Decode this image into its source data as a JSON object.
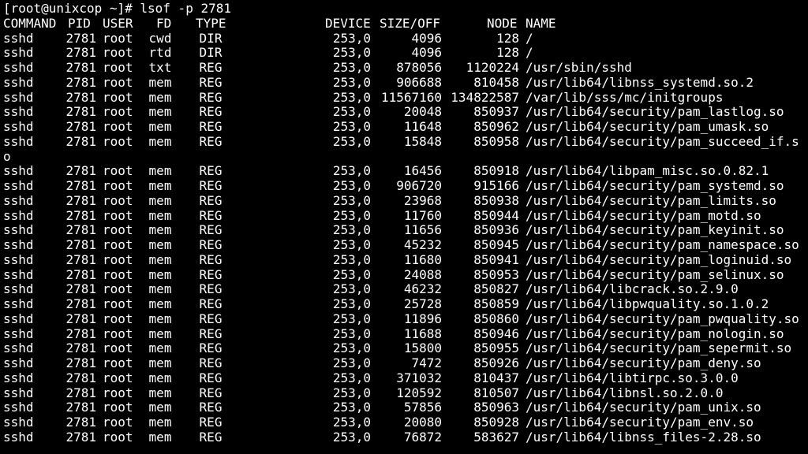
{
  "terminal": {
    "prompt": "[root@unixcop ~]# ",
    "command": "lsof -p 2781",
    "headers": {
      "command": "COMMAND",
      "pid": "PID",
      "user": "USER",
      "fd": "FD",
      "type": "TYPE",
      "device": "DEVICE",
      "size_off": "SIZE/OFF",
      "node": "NODE",
      "name": "NAME"
    },
    "rows": [
      {
        "command": "sshd",
        "pid": "2781",
        "user": "root",
        "fd": "cwd",
        "type": "DIR",
        "device": "253,0",
        "size": "4096",
        "node": "128",
        "name": "/"
      },
      {
        "command": "sshd",
        "pid": "2781",
        "user": "root",
        "fd": "rtd",
        "type": "DIR",
        "device": "253,0",
        "size": "4096",
        "node": "128",
        "name": "/"
      },
      {
        "command": "sshd",
        "pid": "2781",
        "user": "root",
        "fd": "txt",
        "type": "REG",
        "device": "253,0",
        "size": "878056",
        "node": "1120224",
        "name": "/usr/sbin/sshd"
      },
      {
        "command": "sshd",
        "pid": "2781",
        "user": "root",
        "fd": "mem",
        "type": "REG",
        "device": "253,0",
        "size": "906688",
        "node": "810458",
        "name": "/usr/lib64/libnss_systemd.so.2"
      },
      {
        "command": "sshd",
        "pid": "2781",
        "user": "root",
        "fd": "mem",
        "type": "REG",
        "device": "253,0",
        "size": "11567160",
        "node": "134822587",
        "name": "/var/lib/sss/mc/initgroups"
      },
      {
        "command": "sshd",
        "pid": "2781",
        "user": "root",
        "fd": "mem",
        "type": "REG",
        "device": "253,0",
        "size": "20048",
        "node": "850937",
        "name": "/usr/lib64/security/pam_lastlog.so"
      },
      {
        "command": "sshd",
        "pid": "2781",
        "user": "root",
        "fd": "mem",
        "type": "REG",
        "device": "253,0",
        "size": "11648",
        "node": "850962",
        "name": "/usr/lib64/security/pam_umask.so"
      },
      {
        "command": "sshd",
        "pid": "2781",
        "user": "root",
        "fd": "mem",
        "type": "REG",
        "device": "253,0",
        "size": "15848",
        "node": "850958",
        "name": "/usr/lib64/security/pam_succeed_if.s",
        "wrap": "o"
      },
      {
        "command": "sshd",
        "pid": "2781",
        "user": "root",
        "fd": "mem",
        "type": "REG",
        "device": "253,0",
        "size": "16456",
        "node": "850918",
        "name": "/usr/lib64/libpam_misc.so.0.82.1"
      },
      {
        "command": "sshd",
        "pid": "2781",
        "user": "root",
        "fd": "mem",
        "type": "REG",
        "device": "253,0",
        "size": "906720",
        "node": "915166",
        "name": "/usr/lib64/security/pam_systemd.so"
      },
      {
        "command": "sshd",
        "pid": "2781",
        "user": "root",
        "fd": "mem",
        "type": "REG",
        "device": "253,0",
        "size": "23968",
        "node": "850938",
        "name": "/usr/lib64/security/pam_limits.so"
      },
      {
        "command": "sshd",
        "pid": "2781",
        "user": "root",
        "fd": "mem",
        "type": "REG",
        "device": "253,0",
        "size": "11760",
        "node": "850944",
        "name": "/usr/lib64/security/pam_motd.so"
      },
      {
        "command": "sshd",
        "pid": "2781",
        "user": "root",
        "fd": "mem",
        "type": "REG",
        "device": "253,0",
        "size": "11656",
        "node": "850936",
        "name": "/usr/lib64/security/pam_keyinit.so"
      },
      {
        "command": "sshd",
        "pid": "2781",
        "user": "root",
        "fd": "mem",
        "type": "REG",
        "device": "253,0",
        "size": "45232",
        "node": "850945",
        "name": "/usr/lib64/security/pam_namespace.so"
      },
      {
        "command": "sshd",
        "pid": "2781",
        "user": "root",
        "fd": "mem",
        "type": "REG",
        "device": "253,0",
        "size": "11680",
        "node": "850941",
        "name": "/usr/lib64/security/pam_loginuid.so"
      },
      {
        "command": "sshd",
        "pid": "2781",
        "user": "root",
        "fd": "mem",
        "type": "REG",
        "device": "253,0",
        "size": "24088",
        "node": "850953",
        "name": "/usr/lib64/security/pam_selinux.so"
      },
      {
        "command": "sshd",
        "pid": "2781",
        "user": "root",
        "fd": "mem",
        "type": "REG",
        "device": "253,0",
        "size": "46232",
        "node": "850827",
        "name": "/usr/lib64/libcrack.so.2.9.0"
      },
      {
        "command": "sshd",
        "pid": "2781",
        "user": "root",
        "fd": "mem",
        "type": "REG",
        "device": "253,0",
        "size": "25728",
        "node": "850859",
        "name": "/usr/lib64/libpwquality.so.1.0.2"
      },
      {
        "command": "sshd",
        "pid": "2781",
        "user": "root",
        "fd": "mem",
        "type": "REG",
        "device": "253,0",
        "size": "11896",
        "node": "850860",
        "name": "/usr/lib64/security/pam_pwquality.so"
      },
      {
        "command": "sshd",
        "pid": "2781",
        "user": "root",
        "fd": "mem",
        "type": "REG",
        "device": "253,0",
        "size": "11688",
        "node": "850946",
        "name": "/usr/lib64/security/pam_nologin.so"
      },
      {
        "command": "sshd",
        "pid": "2781",
        "user": "root",
        "fd": "mem",
        "type": "REG",
        "device": "253,0",
        "size": "15800",
        "node": "850955",
        "name": "/usr/lib64/security/pam_sepermit.so"
      },
      {
        "command": "sshd",
        "pid": "2781",
        "user": "root",
        "fd": "mem",
        "type": "REG",
        "device": "253,0",
        "size": "7472",
        "node": "850926",
        "name": "/usr/lib64/security/pam_deny.so"
      },
      {
        "command": "sshd",
        "pid": "2781",
        "user": "root",
        "fd": "mem",
        "type": "REG",
        "device": "253,0",
        "size": "371032",
        "node": "810437",
        "name": "/usr/lib64/libtirpc.so.3.0.0"
      },
      {
        "command": "sshd",
        "pid": "2781",
        "user": "root",
        "fd": "mem",
        "type": "REG",
        "device": "253,0",
        "size": "120592",
        "node": "810507",
        "name": "/usr/lib64/libnsl.so.2.0.0"
      },
      {
        "command": "sshd",
        "pid": "2781",
        "user": "root",
        "fd": "mem",
        "type": "REG",
        "device": "253,0",
        "size": "57856",
        "node": "850963",
        "name": "/usr/lib64/security/pam_unix.so"
      },
      {
        "command": "sshd",
        "pid": "2781",
        "user": "root",
        "fd": "mem",
        "type": "REG",
        "device": "253,0",
        "size": "20080",
        "node": "850928",
        "name": "/usr/lib64/security/pam_env.so"
      },
      {
        "command": "sshd",
        "pid": "2781",
        "user": "root",
        "fd": "mem",
        "type": "REG",
        "device": "253,0",
        "size": "76872",
        "node": "583627",
        "name": "/usr/lib64/libnss_files-2.28.so"
      }
    ]
  },
  "colors": {
    "background": "#000000",
    "foreground": "#ffffff"
  }
}
